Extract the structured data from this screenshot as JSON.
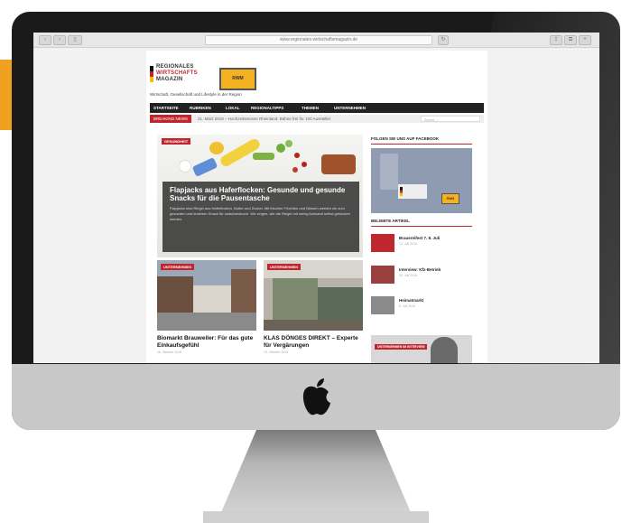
{
  "browser": {
    "url": "www.regionales-wirtschaftsmagazin.de"
  },
  "site": {
    "logo_lines": [
      "REGIONALES",
      "WIRTSCHAFTS",
      "MAGAZIN"
    ],
    "ad_label": "RWM",
    "tagline": "Wirtschaft, Gesellschaft und Lifestyle in der Region",
    "nav": [
      "STARTSEITE",
      "RUBRIKEN",
      "LOKAL",
      "REGIONALTIPPS",
      "THEMEN",
      "UNTERNEHMEN"
    ],
    "ticker_label": "BREAKING NEWS",
    "ticker_text": "21. März 2019 – Hochzeitsmesse Rheinland: Bühne frei für 100 Aussteller",
    "search_placeholder": "Suche ..."
  },
  "hero": {
    "tag": "GESUNDHEIT",
    "title": "Flapjacks aus Haferflocken: Gesunde und gesunde Snacks für die Pausentasche",
    "excerpt": "Flapjacks sind Riegel aus Haferflocken, Butter und Zucker. Mit frischen Früchten und Nüssen werden sie zum gesunden und leckeren Snack für zwischendurch. Wir zeigen, wie die Riegel mit wenig Aufwand selbst gebacken werden."
  },
  "sidebar": {
    "fb_heading": "FOLGEN SIE UNS AUF FACEBOOK",
    "fb_ad_label": "RWM",
    "popular_heading": "BELIEBTE ARTIKEL",
    "popular": [
      {
        "title": "Brauereifest 7. 8. Juli",
        "meta": "12. Juli 2018"
      },
      {
        "title": "Interview: Kfz-Betrieb",
        "meta": "10. Juli 2018"
      },
      {
        "title": "Heimatmarkt",
        "meta": "8. Juli 2018"
      }
    ],
    "banner_tag": "UNTERNEHMEN IM INTERVIEW"
  },
  "cards": [
    {
      "tag": "UNTERNEHMEN",
      "title": "Biomarkt Brauweiler: Für das gute Einkaufsgefühl",
      "meta": "16. Oktober 2018"
    },
    {
      "tag": "UNTERNEHMEN",
      "title": "KLAS DÖNGES DIREKT – Experte für Vergärungen",
      "meta": "13. Oktober 2018"
    }
  ],
  "colors": {
    "brand_red": "#c0262d",
    "brand_yellow": "#f4b223",
    "nav_bg": "#222222",
    "accent_orange": "#f0a020"
  }
}
